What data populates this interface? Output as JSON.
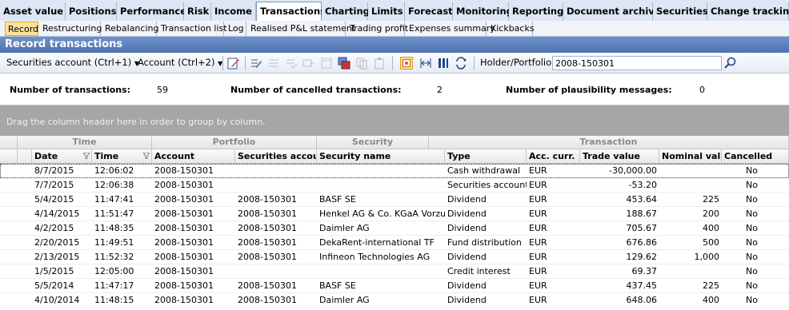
{
  "top_tabs": [
    "Asset value",
    "Positions",
    "Performance",
    "Risk",
    "Income",
    "Transactions",
    "Charting",
    "Limits",
    "Forecast",
    "Monitoring",
    "Reporting",
    "Document archive",
    "Securities",
    "Change tracking"
  ],
  "sub_tabs": [
    "Record",
    "Restructuring",
    "Rebalancing",
    "Transaction list",
    "Log",
    "Realised P&L statement",
    "Trading profit",
    "Expenses summary",
    "Kickbacks"
  ],
  "title": "Record transactions",
  "toolbar": {
    "securities_account_label": "Securities account (Ctrl+1)",
    "account_label": "Account (Ctrl+2)",
    "holder_label": "Holder/Portfolio",
    "holder_value": "2008-150301"
  },
  "summary": {
    "transactions_label": "Number of transactions:",
    "transactions_value": "59",
    "cancelled_label": "Number of cancelled transactions:",
    "cancelled_value": "2",
    "plausibility_label": "Number of plausibility messages:",
    "plausibility_value": "0"
  },
  "group_hint": "Drag the column header here in order to group by column.",
  "bands": {
    "time": "Time",
    "portfolio": "Portfolio",
    "security": "Security",
    "transaction": "Transaction"
  },
  "columns": {
    "date": "Date",
    "time": "Time",
    "account": "Account",
    "sec_account": "Securities account",
    "sec_name": "Security name",
    "type": "Type",
    "acc_curr": "Acc. curr.",
    "trade_value": "Trade value",
    "nominal": "Nominal value",
    "cancelled": "Cancelled"
  },
  "rows": [
    {
      "date": "8/7/2015",
      "time": "12:06:02",
      "account": "2008-150301",
      "sec_account": "",
      "sec_name": "",
      "type": "Cash withdrawal",
      "acc_curr": "EUR",
      "trade_value": "-30,000.00",
      "nominal": "",
      "cancelled": "No"
    },
    {
      "date": "7/7/2015",
      "time": "12:06:38",
      "account": "2008-150301",
      "sec_account": "",
      "sec_name": "",
      "type": "Securities account fees",
      "acc_curr": "EUR",
      "trade_value": "-53.20",
      "nominal": "",
      "cancelled": "No"
    },
    {
      "date": "5/4/2015",
      "time": "11:47:41",
      "account": "2008-150301",
      "sec_account": "2008-150301",
      "sec_name": "BASF SE",
      "type": "Dividend",
      "acc_curr": "EUR",
      "trade_value": "453.64",
      "nominal": "225",
      "cancelled": "No"
    },
    {
      "date": "4/14/2015",
      "time": "11:51:47",
      "account": "2008-150301",
      "sec_account": "2008-150301",
      "sec_name": "Henkel AG & Co. KGaA Vorzugsaktien",
      "type": "Dividend",
      "acc_curr": "EUR",
      "trade_value": "188.67",
      "nominal": "200",
      "cancelled": "No"
    },
    {
      "date": "4/2/2015",
      "time": "11:48:35",
      "account": "2008-150301",
      "sec_account": "2008-150301",
      "sec_name": "Daimler AG",
      "type": "Dividend",
      "acc_curr": "EUR",
      "trade_value": "705.67",
      "nominal": "400",
      "cancelled": "No"
    },
    {
      "date": "2/20/2015",
      "time": "11:49:51",
      "account": "2008-150301",
      "sec_account": "2008-150301",
      "sec_name": "DekaRent-international TF",
      "type": "Fund distribution",
      "acc_curr": "EUR",
      "trade_value": "676.86",
      "nominal": "500",
      "cancelled": "No"
    },
    {
      "date": "2/13/2015",
      "time": "11:52:32",
      "account": "2008-150301",
      "sec_account": "2008-150301",
      "sec_name": "Infineon Technologies AG",
      "type": "Dividend",
      "acc_curr": "EUR",
      "trade_value": "129.62",
      "nominal": "1,000",
      "cancelled": "No"
    },
    {
      "date": "1/5/2015",
      "time": "12:05:00",
      "account": "2008-150301",
      "sec_account": "",
      "sec_name": "",
      "type": "Credit interest",
      "acc_curr": "EUR",
      "trade_value": "69.37",
      "nominal": "",
      "cancelled": "No"
    },
    {
      "date": "5/5/2014",
      "time": "11:47:17",
      "account": "2008-150301",
      "sec_account": "2008-150301",
      "sec_name": "BASF SE",
      "type": "Dividend",
      "acc_curr": "EUR",
      "trade_value": "437.45",
      "nominal": "225",
      "cancelled": "No"
    },
    {
      "date": "4/10/2014",
      "time": "11:48:15",
      "account": "2008-150301",
      "sec_account": "2008-150301",
      "sec_name": "Daimler AG",
      "type": "Dividend",
      "acc_curr": "EUR",
      "trade_value": "648.06",
      "nominal": "400",
      "cancelled": "No"
    }
  ]
}
